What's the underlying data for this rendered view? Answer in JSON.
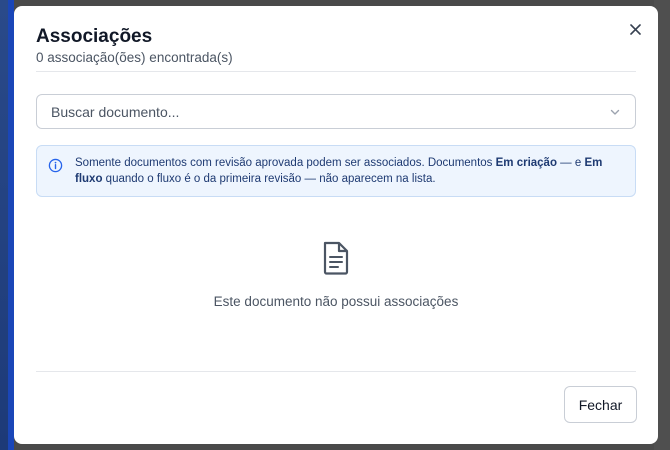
{
  "modal": {
    "title": "Associações",
    "subtitle": "0 associação(ões) encontrada(s)",
    "close_icon": "close-icon"
  },
  "search": {
    "placeholder": "Buscar documento...",
    "icon": "chevron-down-icon"
  },
  "info": {
    "icon": "info-icon",
    "text_1": "Somente documentos com revisão aprovada podem ser associados. Documentos ",
    "bold_1": "Em criação",
    "text_2": " — e ",
    "bold_2": "Em fluxo",
    "text_3": " quando o fluxo é o da primeira revisão — não aparecem na lista."
  },
  "empty_state": {
    "icon": "document-icon",
    "text": "Este documento não possui associações"
  },
  "footer": {
    "close_label": "Fechar"
  },
  "colors": {
    "info_background": "#eef5fe",
    "info_text": "#1e3a72",
    "sidebar_accent": "#1a46b8"
  }
}
